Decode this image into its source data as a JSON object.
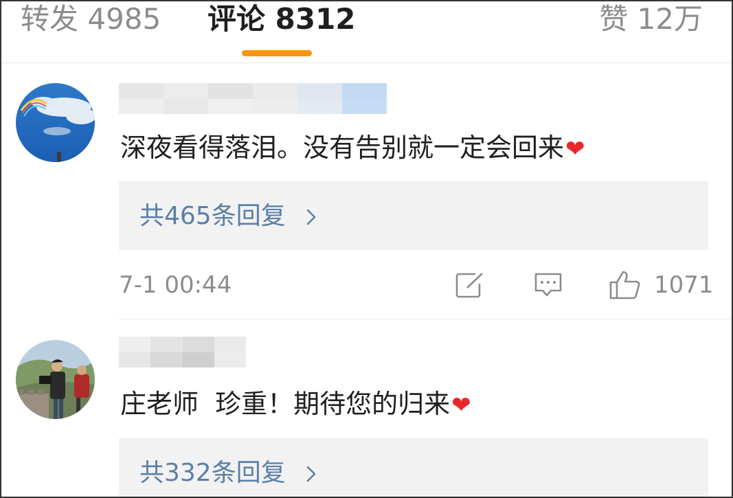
{
  "tabs": {
    "repost_label": "转发 4985",
    "comments_label": "评论 8312",
    "likes_label": "赞 12万"
  },
  "colors": {
    "accent": "#f7960d",
    "link": "#5a7fa8",
    "heart": "#e8262b",
    "muted": "#8c8c8c"
  },
  "comments": [
    {
      "text": "深夜看得落泪。没有告别就一定会回来",
      "replies_label": "共465条回复",
      "timestamp": "7-1 00:44",
      "likes": "1071",
      "icons": [
        "share-icon",
        "reply-icon",
        "thumbs-up-icon",
        "chevron-right-icon",
        "heart-emoji"
      ]
    },
    {
      "text": "庄老师  珍重！期待您的归来",
      "replies_label": "共332条回复",
      "icons": [
        "chevron-right-icon",
        "heart-emoji"
      ]
    }
  ]
}
